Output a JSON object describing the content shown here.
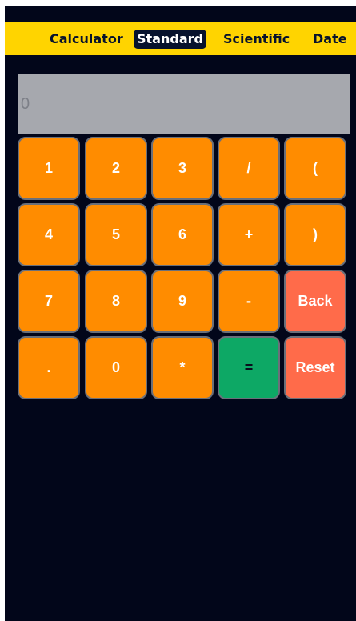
{
  "header": {
    "tabs": [
      {
        "label": "Calculator",
        "active": false
      },
      {
        "label": "Standard",
        "active": true
      },
      {
        "label": "Scientific",
        "active": false
      },
      {
        "label": "Date",
        "active": false
      }
    ]
  },
  "display": {
    "value": "0"
  },
  "keypad": {
    "rows": [
      [
        "1",
        "2",
        "3",
        "/",
        "("
      ],
      [
        "4",
        "5",
        "6",
        "+",
        ")"
      ],
      [
        "7",
        "8",
        "9",
        "-",
        "Back"
      ],
      [
        ".",
        "0",
        "*",
        "=",
        "Reset"
      ]
    ]
  },
  "colors": {
    "header_bg": "#ffd400",
    "app_bg": "#02061a",
    "key_orange": "#ff8c00",
    "key_red": "#ff6b4a",
    "key_green": "#0da865",
    "display_bg": "#a6a8ae"
  }
}
